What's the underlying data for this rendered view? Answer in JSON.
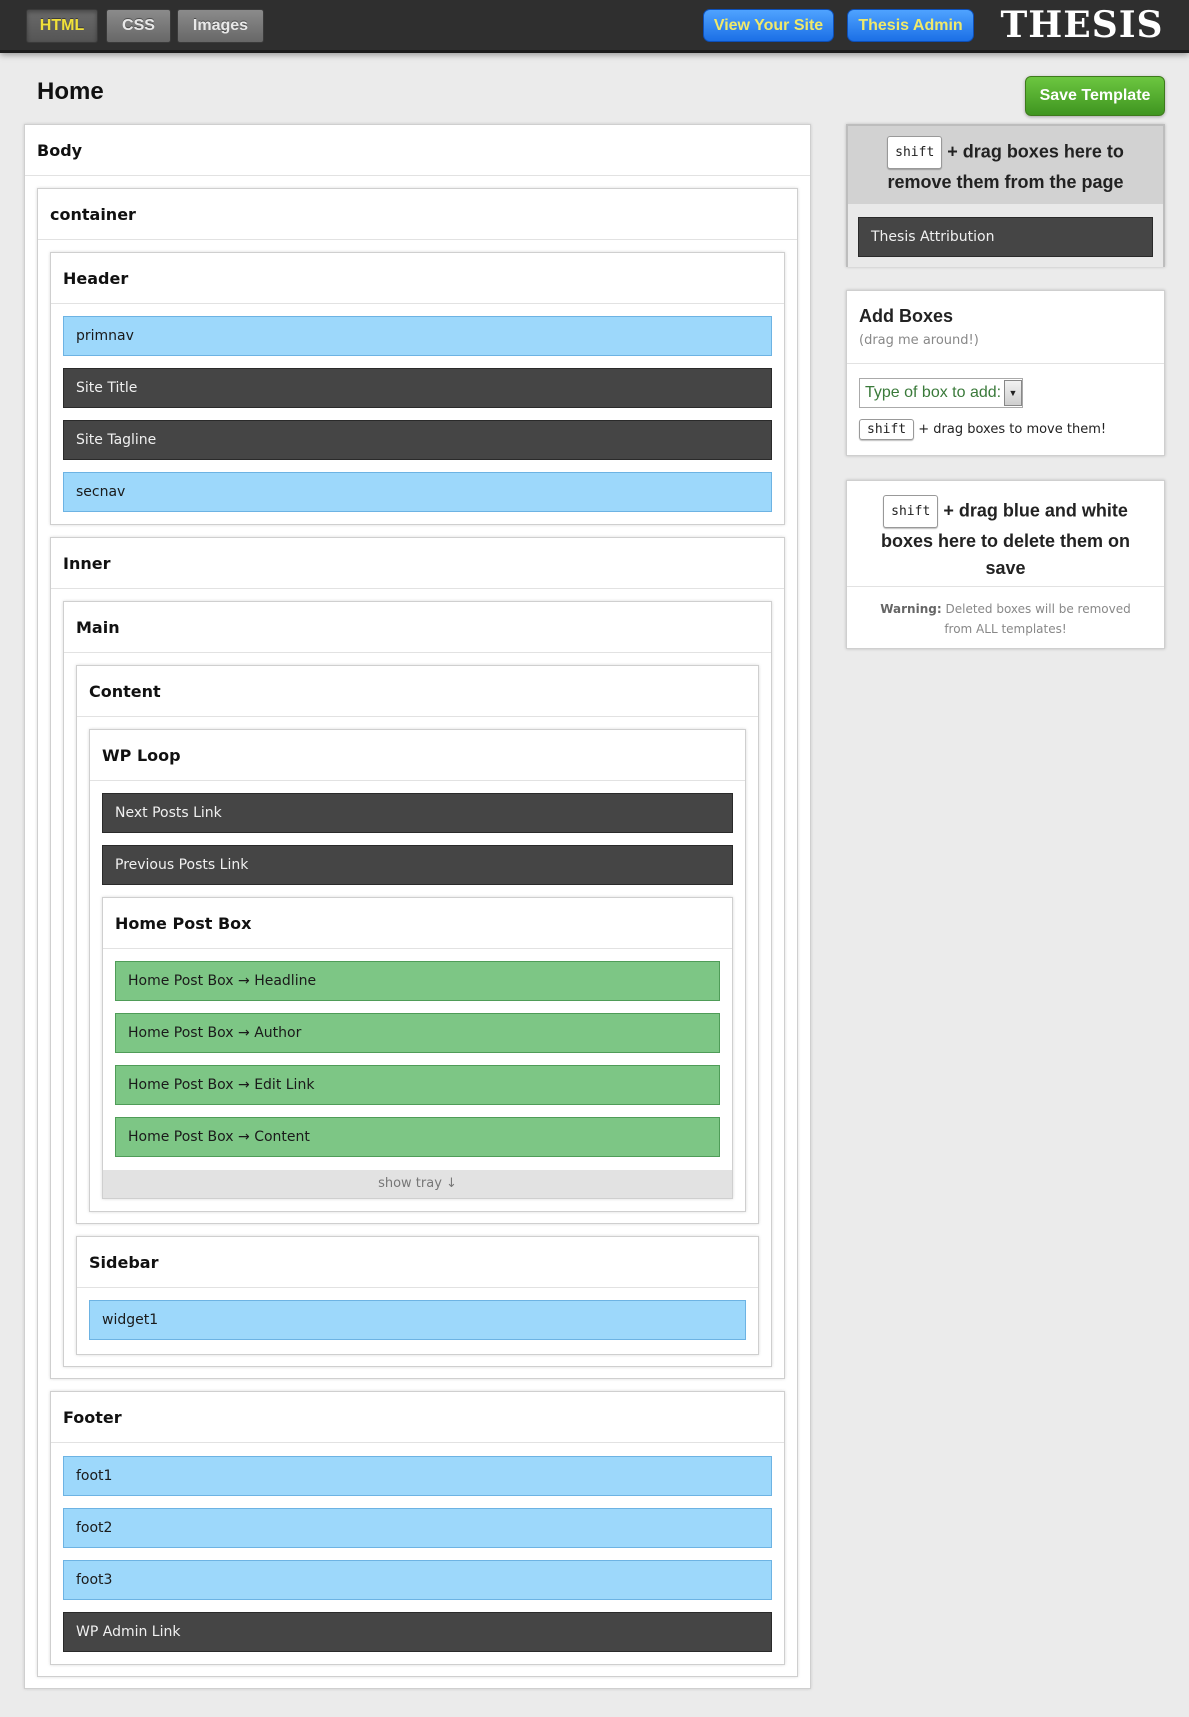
{
  "topbar": {
    "tabs": [
      {
        "label": "HTML",
        "active": true
      },
      {
        "label": "CSS",
        "active": false
      },
      {
        "label": "Images",
        "active": false
      }
    ],
    "view_site": "View Your Site",
    "thesis_admin": "Thesis Admin",
    "logo": "THESIS"
  },
  "page": {
    "title": "Home",
    "save_button": "Save Template"
  },
  "layout": {
    "body": "Body",
    "container": "container",
    "header": {
      "title": "Header",
      "items": [
        "primnav",
        "Site Title",
        "Site Tagline",
        "secnav"
      ]
    },
    "inner": "Inner",
    "main": "Main",
    "content": "Content",
    "wp_loop": {
      "title": "WP Loop",
      "items": [
        "Next Posts Link",
        "Previous Posts Link"
      ]
    },
    "home_post_box": {
      "title": "Home Post Box",
      "items": [
        "Home Post Box → Headline",
        "Home Post Box → Author",
        "Home Post Box → Edit Link",
        "Home Post Box → Content"
      ],
      "tray": "show tray ↓"
    },
    "sidebar": {
      "title": "Sidebar",
      "items": [
        "widget1"
      ]
    },
    "footer": {
      "title": "Footer",
      "items": [
        "foot1",
        "foot2",
        "foot3",
        "WP Admin Link"
      ]
    }
  },
  "right": {
    "remove_panel": {
      "key": "shift",
      "text": "+ drag boxes here to remove them from the page",
      "items": [
        "Thesis Attribution"
      ]
    },
    "add_panel": {
      "title": "Add Boxes",
      "subtitle": "(drag me around!)",
      "select_placeholder": "Type of box to add:",
      "hint_key": "shift",
      "hint_text": "+ drag boxes to move them!"
    },
    "delete_panel": {
      "key": "shift",
      "text": "+ drag blue and white boxes here to delete them on save",
      "warning_label": "Warning:",
      "warning_text": "Deleted boxes will be removed from ALL templates!"
    }
  },
  "colors": {
    "blue_box": "#9dd8fb",
    "dark_box": "#454545",
    "green_box": "#7dc685",
    "save_green": "#4fa82a",
    "link_blue": "#2a84ff"
  }
}
